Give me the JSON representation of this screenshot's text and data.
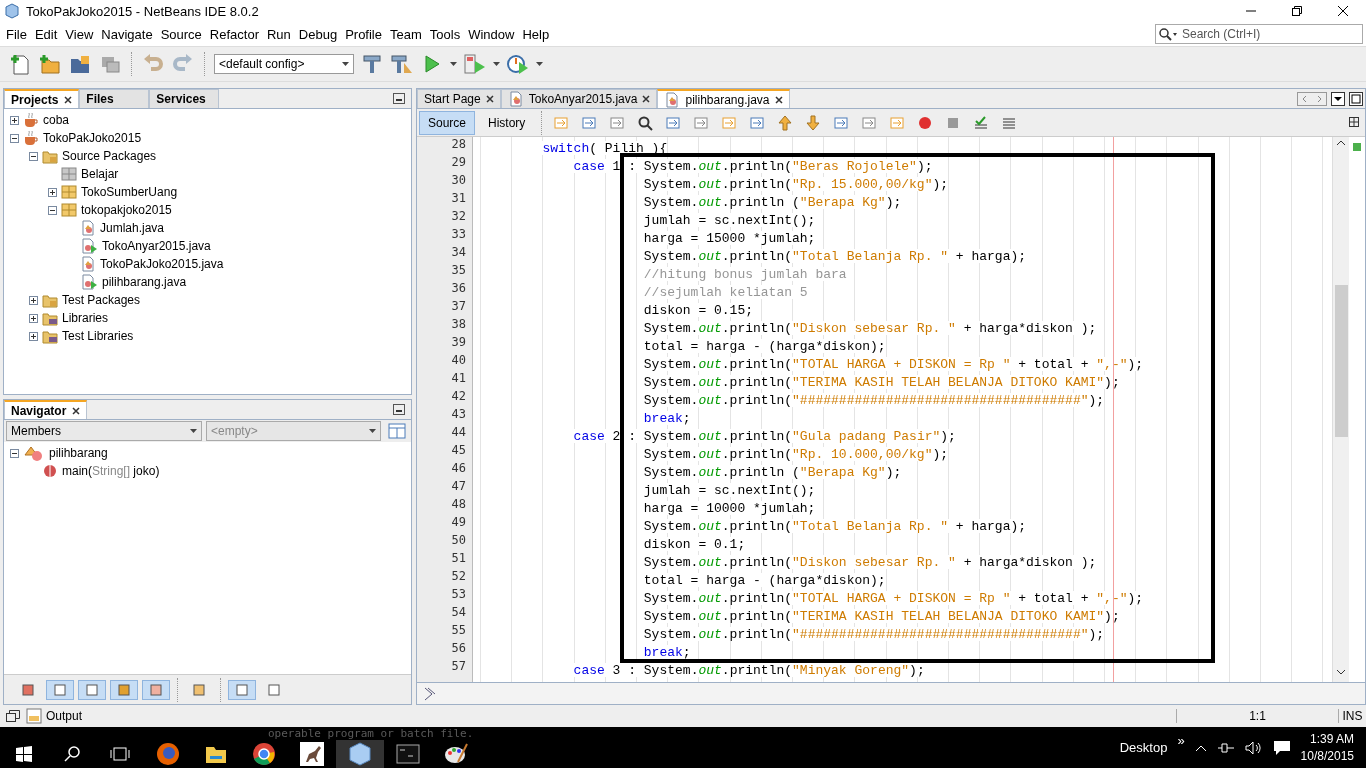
{
  "window": {
    "title": "TokoPakJoko2015 - NetBeans IDE 8.0.2"
  },
  "menu": [
    "File",
    "Edit",
    "View",
    "Navigate",
    "Source",
    "Refactor",
    "Run",
    "Debug",
    "Profile",
    "Team",
    "Tools",
    "Window",
    "Help"
  ],
  "search": {
    "placeholder": "Search (Ctrl+I)"
  },
  "toolbar": {
    "config": "<default config>"
  },
  "projects_panel": {
    "tabs": [
      {
        "label": "Projects",
        "selected": true
      },
      {
        "label": "Files",
        "selected": false
      },
      {
        "label": "Services",
        "selected": false
      }
    ],
    "tree": [
      {
        "label": "coba",
        "kind": "project",
        "expanded": false
      },
      {
        "label": "TokoPakJoko2015",
        "kind": "project",
        "expanded": true,
        "children": [
          {
            "label": "Source Packages",
            "kind": "folder",
            "expanded": true,
            "children": [
              {
                "label": "Belajar",
                "kind": "empty-package"
              },
              {
                "label": "TokoSumberUang",
                "kind": "package",
                "expanded": false
              },
              {
                "label": "tokopakjoko2015",
                "kind": "package",
                "expanded": true,
                "children": [
                  {
                    "label": "Jumlah.java",
                    "kind": "java"
                  },
                  {
                    "label": "TokoAnyar2015.java",
                    "kind": "java-main"
                  },
                  {
                    "label": "TokoPakJoko2015.java",
                    "kind": "java"
                  },
                  {
                    "label": "pilihbarang.java",
                    "kind": "java-main"
                  }
                ]
              }
            ]
          },
          {
            "label": "Test Packages",
            "kind": "folder",
            "expanded": false
          },
          {
            "label": "Libraries",
            "kind": "library",
            "expanded": false
          },
          {
            "label": "Test Libraries",
            "kind": "library",
            "expanded": false
          }
        ]
      }
    ]
  },
  "navigator": {
    "title": "Navigator",
    "filter": "Members",
    "secondary_filter": "<empty>",
    "tree": [
      {
        "label": "pilihbarang",
        "kind": "class",
        "expanded": true,
        "children": [
          {
            "kind": "method",
            "text_before": "main(",
            "text_muted": "String[]",
            "text_after": " joko)"
          }
        ]
      }
    ],
    "filter_toggles": [
      {
        "on": false
      },
      {
        "on": true
      },
      {
        "on": true
      },
      {
        "on": true
      },
      {
        "on": true
      },
      {
        "on": false
      },
      {
        "on": true
      },
      {
        "on": false
      }
    ]
  },
  "editor": {
    "tabs": [
      {
        "label": "Start Page",
        "selected": false,
        "kind": "page"
      },
      {
        "label": "TokoAnyar2015.java",
        "selected": false,
        "kind": "java"
      },
      {
        "label": "pilihbarang.java",
        "selected": true,
        "kind": "java"
      }
    ],
    "views": [
      {
        "label": "Source",
        "selected": true
      },
      {
        "label": "History",
        "selected": false
      }
    ],
    "lines": [
      {
        "number": "28",
        "kind": "block",
        "tokens": [
          {
            "kind": "keyword",
            "text": "switch"
          },
          {
            "kind": "plain",
            "text": "( Pilih ){"
          }
        ]
      },
      {
        "number": "29",
        "kind": "case",
        "tokens": [
          {
            "kind": "keyword",
            "text": "case"
          },
          {
            "kind": "plain",
            "text": " 1 : System."
          },
          {
            "kind": "field",
            "text": "out"
          },
          {
            "kind": "plain",
            "text": ".println("
          },
          {
            "kind": "string",
            "text": "\"Beras Rojolele\""
          },
          {
            "kind": "plain",
            "text": ");"
          }
        ]
      },
      {
        "number": "30",
        "kind": "stmt",
        "tokens": [
          {
            "kind": "plain",
            "text": "System."
          },
          {
            "kind": "field",
            "text": "out"
          },
          {
            "kind": "plain",
            "text": ".println("
          },
          {
            "kind": "string",
            "text": "\"Rp. 15.000,00/kg\""
          },
          {
            "kind": "plain",
            "text": ");"
          }
        ]
      },
      {
        "number": "31",
        "kind": "stmt",
        "tokens": [
          {
            "kind": "plain",
            "text": "System."
          },
          {
            "kind": "field",
            "text": "out"
          },
          {
            "kind": "plain",
            "text": ".println ("
          },
          {
            "kind": "string",
            "text": "\"Berapa Kg\""
          },
          {
            "kind": "plain",
            "text": ");"
          }
        ]
      },
      {
        "number": "32",
        "kind": "stmt",
        "tokens": [
          {
            "kind": "plain",
            "text": "jumlah = sc.nextInt();"
          }
        ]
      },
      {
        "number": "33",
        "kind": "stmt",
        "tokens": [
          {
            "kind": "plain",
            "text": "harga = 15000 *jumlah;"
          }
        ]
      },
      {
        "number": "34",
        "kind": "stmt",
        "tokens": [
          {
            "kind": "plain",
            "text": "System."
          },
          {
            "kind": "field",
            "text": "out"
          },
          {
            "kind": "plain",
            "text": ".println("
          },
          {
            "kind": "string",
            "text": "\"Total Belanja Rp. \""
          },
          {
            "kind": "plain",
            "text": " + harga);"
          }
        ]
      },
      {
        "number": "35",
        "kind": "stmt",
        "tokens": [
          {
            "kind": "comment",
            "text": "//hitung bonus jumlah bara"
          }
        ]
      },
      {
        "number": "36",
        "kind": "stmt",
        "tokens": [
          {
            "kind": "comment",
            "text": "//sejumlah keliatan 5"
          }
        ]
      },
      {
        "number": "37",
        "kind": "stmt",
        "tokens": [
          {
            "kind": "plain",
            "text": "diskon = 0.15;"
          }
        ]
      },
      {
        "number": "38",
        "kind": "stmt",
        "tokens": [
          {
            "kind": "plain",
            "text": "System."
          },
          {
            "kind": "field",
            "text": "out"
          },
          {
            "kind": "plain",
            "text": ".println("
          },
          {
            "kind": "string",
            "text": "\"Diskon sebesar Rp. \""
          },
          {
            "kind": "plain",
            "text": " + harga*diskon );"
          }
        ]
      },
      {
        "number": "39",
        "kind": "stmt",
        "tokens": [
          {
            "kind": "plain",
            "text": "total = harga - (harga*diskon);"
          }
        ]
      },
      {
        "number": "40",
        "kind": "stmt",
        "tokens": [
          {
            "kind": "plain",
            "text": "System."
          },
          {
            "kind": "field",
            "text": "out"
          },
          {
            "kind": "plain",
            "text": ".println("
          },
          {
            "kind": "string",
            "text": "\"TOTAL HARGA + DISKON = Rp \""
          },
          {
            "kind": "plain",
            "text": " + total + "
          },
          {
            "kind": "string",
            "text": "\",-\""
          },
          {
            "kind": "plain",
            "text": ");"
          }
        ]
      },
      {
        "number": "41",
        "kind": "stmt",
        "tokens": [
          {
            "kind": "plain",
            "text": "System."
          },
          {
            "kind": "field",
            "text": "out"
          },
          {
            "kind": "plain",
            "text": ".println("
          },
          {
            "kind": "string",
            "text": "\"TERIMA KASIH TELAH BELANJA DITOKO KAMI\""
          },
          {
            "kind": "plain",
            "text": ");"
          }
        ]
      },
      {
        "number": "42",
        "kind": "stmt",
        "tokens": [
          {
            "kind": "plain",
            "text": "System."
          },
          {
            "kind": "field",
            "text": "out"
          },
          {
            "kind": "plain",
            "text": ".println("
          },
          {
            "kind": "string",
            "text": "\"####################################\""
          },
          {
            "kind": "plain",
            "text": ");"
          }
        ]
      },
      {
        "number": "43",
        "kind": "stmt",
        "tokens": [
          {
            "kind": "keyword",
            "text": "break"
          },
          {
            "kind": "plain",
            "text": ";"
          }
        ]
      },
      {
        "number": "44",
        "kind": "case",
        "tokens": [
          {
            "kind": "keyword",
            "text": "case"
          },
          {
            "kind": "plain",
            "text": " 2 : System."
          },
          {
            "kind": "field",
            "text": "out"
          },
          {
            "kind": "plain",
            "text": ".println("
          },
          {
            "kind": "string",
            "text": "\"Gula padang Pasir\""
          },
          {
            "kind": "plain",
            "text": ");"
          }
        ]
      },
      {
        "number": "45",
        "kind": "stmt",
        "tokens": [
          {
            "kind": "plain",
            "text": "System."
          },
          {
            "kind": "field",
            "text": "out"
          },
          {
            "kind": "plain",
            "text": ".println("
          },
          {
            "kind": "string",
            "text": "\"Rp. 10.000,00/kg\""
          },
          {
            "kind": "plain",
            "text": ");"
          }
        ]
      },
      {
        "number": "46",
        "kind": "stmt",
        "tokens": [
          {
            "kind": "plain",
            "text": "System."
          },
          {
            "kind": "field",
            "text": "out"
          },
          {
            "kind": "plain",
            "text": ".println ("
          },
          {
            "kind": "string",
            "text": "\"Berapa Kg\""
          },
          {
            "kind": "plain",
            "text": ");"
          }
        ]
      },
      {
        "number": "47",
        "kind": "stmt",
        "tokens": [
          {
            "kind": "plain",
            "text": "jumlah = sc.nextInt();"
          }
        ]
      },
      {
        "number": "48",
        "kind": "stmt",
        "tokens": [
          {
            "kind": "plain",
            "text": "harga = 10000 *jumlah;"
          }
        ]
      },
      {
        "number": "49",
        "kind": "stmt",
        "tokens": [
          {
            "kind": "plain",
            "text": "System."
          },
          {
            "kind": "field",
            "text": "out"
          },
          {
            "kind": "plain",
            "text": ".println("
          },
          {
            "kind": "string",
            "text": "\"Total Belanja Rp. \""
          },
          {
            "kind": "plain",
            "text": " + harga);"
          }
        ]
      },
      {
        "number": "50",
        "kind": "stmt",
        "tokens": [
          {
            "kind": "plain",
            "text": "diskon = 0.1;"
          }
        ]
      },
      {
        "number": "51",
        "kind": "stmt",
        "tokens": [
          {
            "kind": "plain",
            "text": "System."
          },
          {
            "kind": "field",
            "text": "out"
          },
          {
            "kind": "plain",
            "text": ".println("
          },
          {
            "kind": "string",
            "text": "\"Diskon sebesar Rp. \""
          },
          {
            "kind": "plain",
            "text": " + harga*diskon );"
          }
        ]
      },
      {
        "number": "52",
        "kind": "stmt",
        "tokens": [
          {
            "kind": "plain",
            "text": "total = harga - (harga*diskon);"
          }
        ]
      },
      {
        "number": "53",
        "kind": "stmt",
        "tokens": [
          {
            "kind": "plain",
            "text": "System."
          },
          {
            "kind": "field",
            "text": "out"
          },
          {
            "kind": "plain",
            "text": ".println("
          },
          {
            "kind": "string",
            "text": "\"TOTAL HARGA + DISKON = Rp \""
          },
          {
            "kind": "plain",
            "text": " + total + "
          },
          {
            "kind": "string",
            "text": "\",-\""
          },
          {
            "kind": "plain",
            "text": ");"
          }
        ]
      },
      {
        "number": "54",
        "kind": "stmt",
        "tokens": [
          {
            "kind": "plain",
            "text": "System."
          },
          {
            "kind": "field",
            "text": "out"
          },
          {
            "kind": "plain",
            "text": ".println("
          },
          {
            "kind": "string",
            "text": "\"TERIMA KASIH TELAH BELANJA DITOKO KAMI\""
          },
          {
            "kind": "plain",
            "text": ");"
          }
        ]
      },
      {
        "number": "55",
        "kind": "stmt",
        "tokens": [
          {
            "kind": "plain",
            "text": "System."
          },
          {
            "kind": "field",
            "text": "out"
          },
          {
            "kind": "plain",
            "text": ".println("
          },
          {
            "kind": "string",
            "text": "\"####################################\""
          },
          {
            "kind": "plain",
            "text": ");"
          }
        ]
      },
      {
        "number": "56",
        "kind": "stmt",
        "tokens": [
          {
            "kind": "keyword",
            "text": "break"
          },
          {
            "kind": "plain",
            "text": ";"
          }
        ]
      },
      {
        "number": "57",
        "kind": "case",
        "tokens": [
          {
            "kind": "keyword",
            "text": "case"
          },
          {
            "kind": "plain",
            "text": " 3 : System."
          },
          {
            "kind": "field",
            "text": "out"
          },
          {
            "kind": "plain",
            "text": ".println("
          },
          {
            "kind": "string",
            "text": "\"Minyak Goreng\""
          },
          {
            "kind": "plain",
            "text": ");"
          }
        ]
      }
    ]
  },
  "status_bar": {
    "output": "Output",
    "position": "1:1",
    "mode": "INS"
  },
  "taskbar": {
    "ghost_text": "operable program or batch file.",
    "desktop": "Desktop",
    "more": "»",
    "time": "1:39 AM",
    "date": "10/8/2015"
  }
}
